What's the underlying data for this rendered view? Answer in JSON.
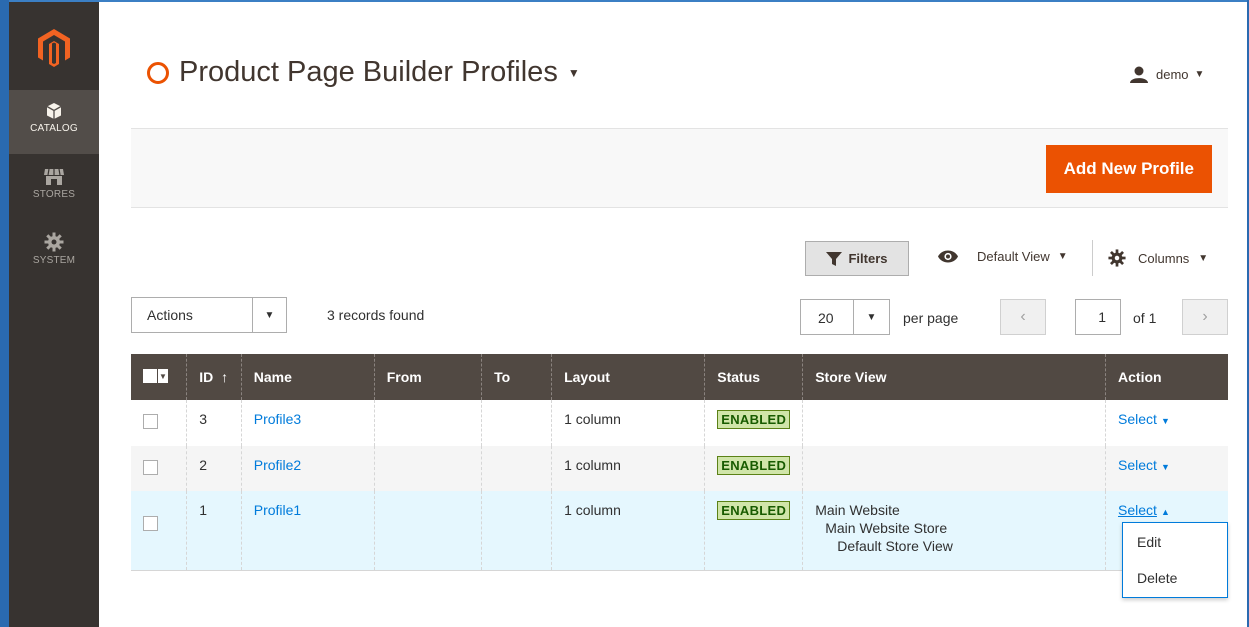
{
  "sidebar": {
    "items": [
      {
        "label": "CATALOG",
        "icon": "box-icon"
      },
      {
        "label": "STORES",
        "icon": "store-icon"
      },
      {
        "label": "SYSTEM",
        "icon": "gear-icon"
      }
    ]
  },
  "header": {
    "title": "Product Page Builder Profiles",
    "user": "demo"
  },
  "toolbar": {
    "add_label": "Add New Profile"
  },
  "grid_controls": {
    "filters_label": "Filters",
    "view_label": "Default View",
    "columns_label": "Columns",
    "actions_label": "Actions",
    "records_found": "3 records found",
    "per_page_value": "20",
    "per_page_label": "per page",
    "page_value": "1",
    "page_of": "of 1"
  },
  "table": {
    "columns": [
      "ID",
      "Name",
      "From",
      "To",
      "Layout",
      "Status",
      "Store View",
      "Action"
    ],
    "id_sort_arrow": "↑",
    "rows": [
      {
        "id": "3",
        "name": "Profile3",
        "from": "",
        "to": "",
        "layout": "1 column",
        "status": "ENABLED",
        "store": [
          "",
          "",
          ""
        ],
        "action": "Select"
      },
      {
        "id": "2",
        "name": "Profile2",
        "from": "",
        "to": "",
        "layout": "1 column",
        "status": "ENABLED",
        "store": [
          "",
          "",
          ""
        ],
        "action": "Select"
      },
      {
        "id": "1",
        "name": "Profile1",
        "from": "",
        "to": "",
        "layout": "1 column",
        "status": "ENABLED",
        "store": [
          "Main Website",
          "Main Website Store",
          "Default Store View"
        ],
        "action": "Select"
      }
    ]
  },
  "action_menu": {
    "items": [
      "Edit",
      "Delete"
    ]
  },
  "colors": {
    "accent": "#eb5202",
    "sidebar": "#373330",
    "table_header": "#514943",
    "link": "#007bdb"
  }
}
